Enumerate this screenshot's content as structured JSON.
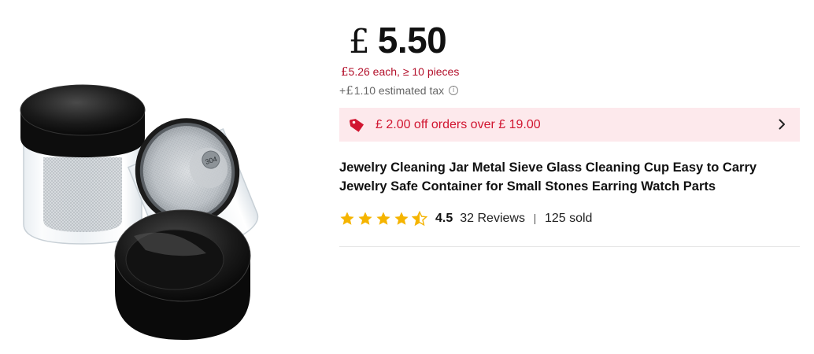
{
  "product": {
    "image_alt": "Jewelry cleaning jar with metal sieve and black lids",
    "price": {
      "currency": "£",
      "amount": "5.50"
    },
    "bulk_price": {
      "currency": "£",
      "text": "5.26 each, ≥ 10 pieces"
    },
    "tax": {
      "prefix": "+",
      "currency": "£",
      "text": "1.10 estimated tax"
    },
    "promo": {
      "text": "£ 2.00 off orders over £ 19.00",
      "icon": "price-tag-icon"
    },
    "title": "Jewelry Cleaning Jar Metal Sieve Glass Cleaning Cup Easy to Carry Jewelry Safe Container for Small Stones Earring Watch Parts",
    "rating": {
      "score": "4.5",
      "stars_value": 4.5,
      "stars_max": 5,
      "reviews": "32 Reviews",
      "sold": "125 sold"
    },
    "sieve_label": "304"
  },
  "colors": {
    "promo_bg": "#fde9ec",
    "promo_text": "#d11530",
    "bulk_text": "#b3102b",
    "star": "#f5b400"
  }
}
